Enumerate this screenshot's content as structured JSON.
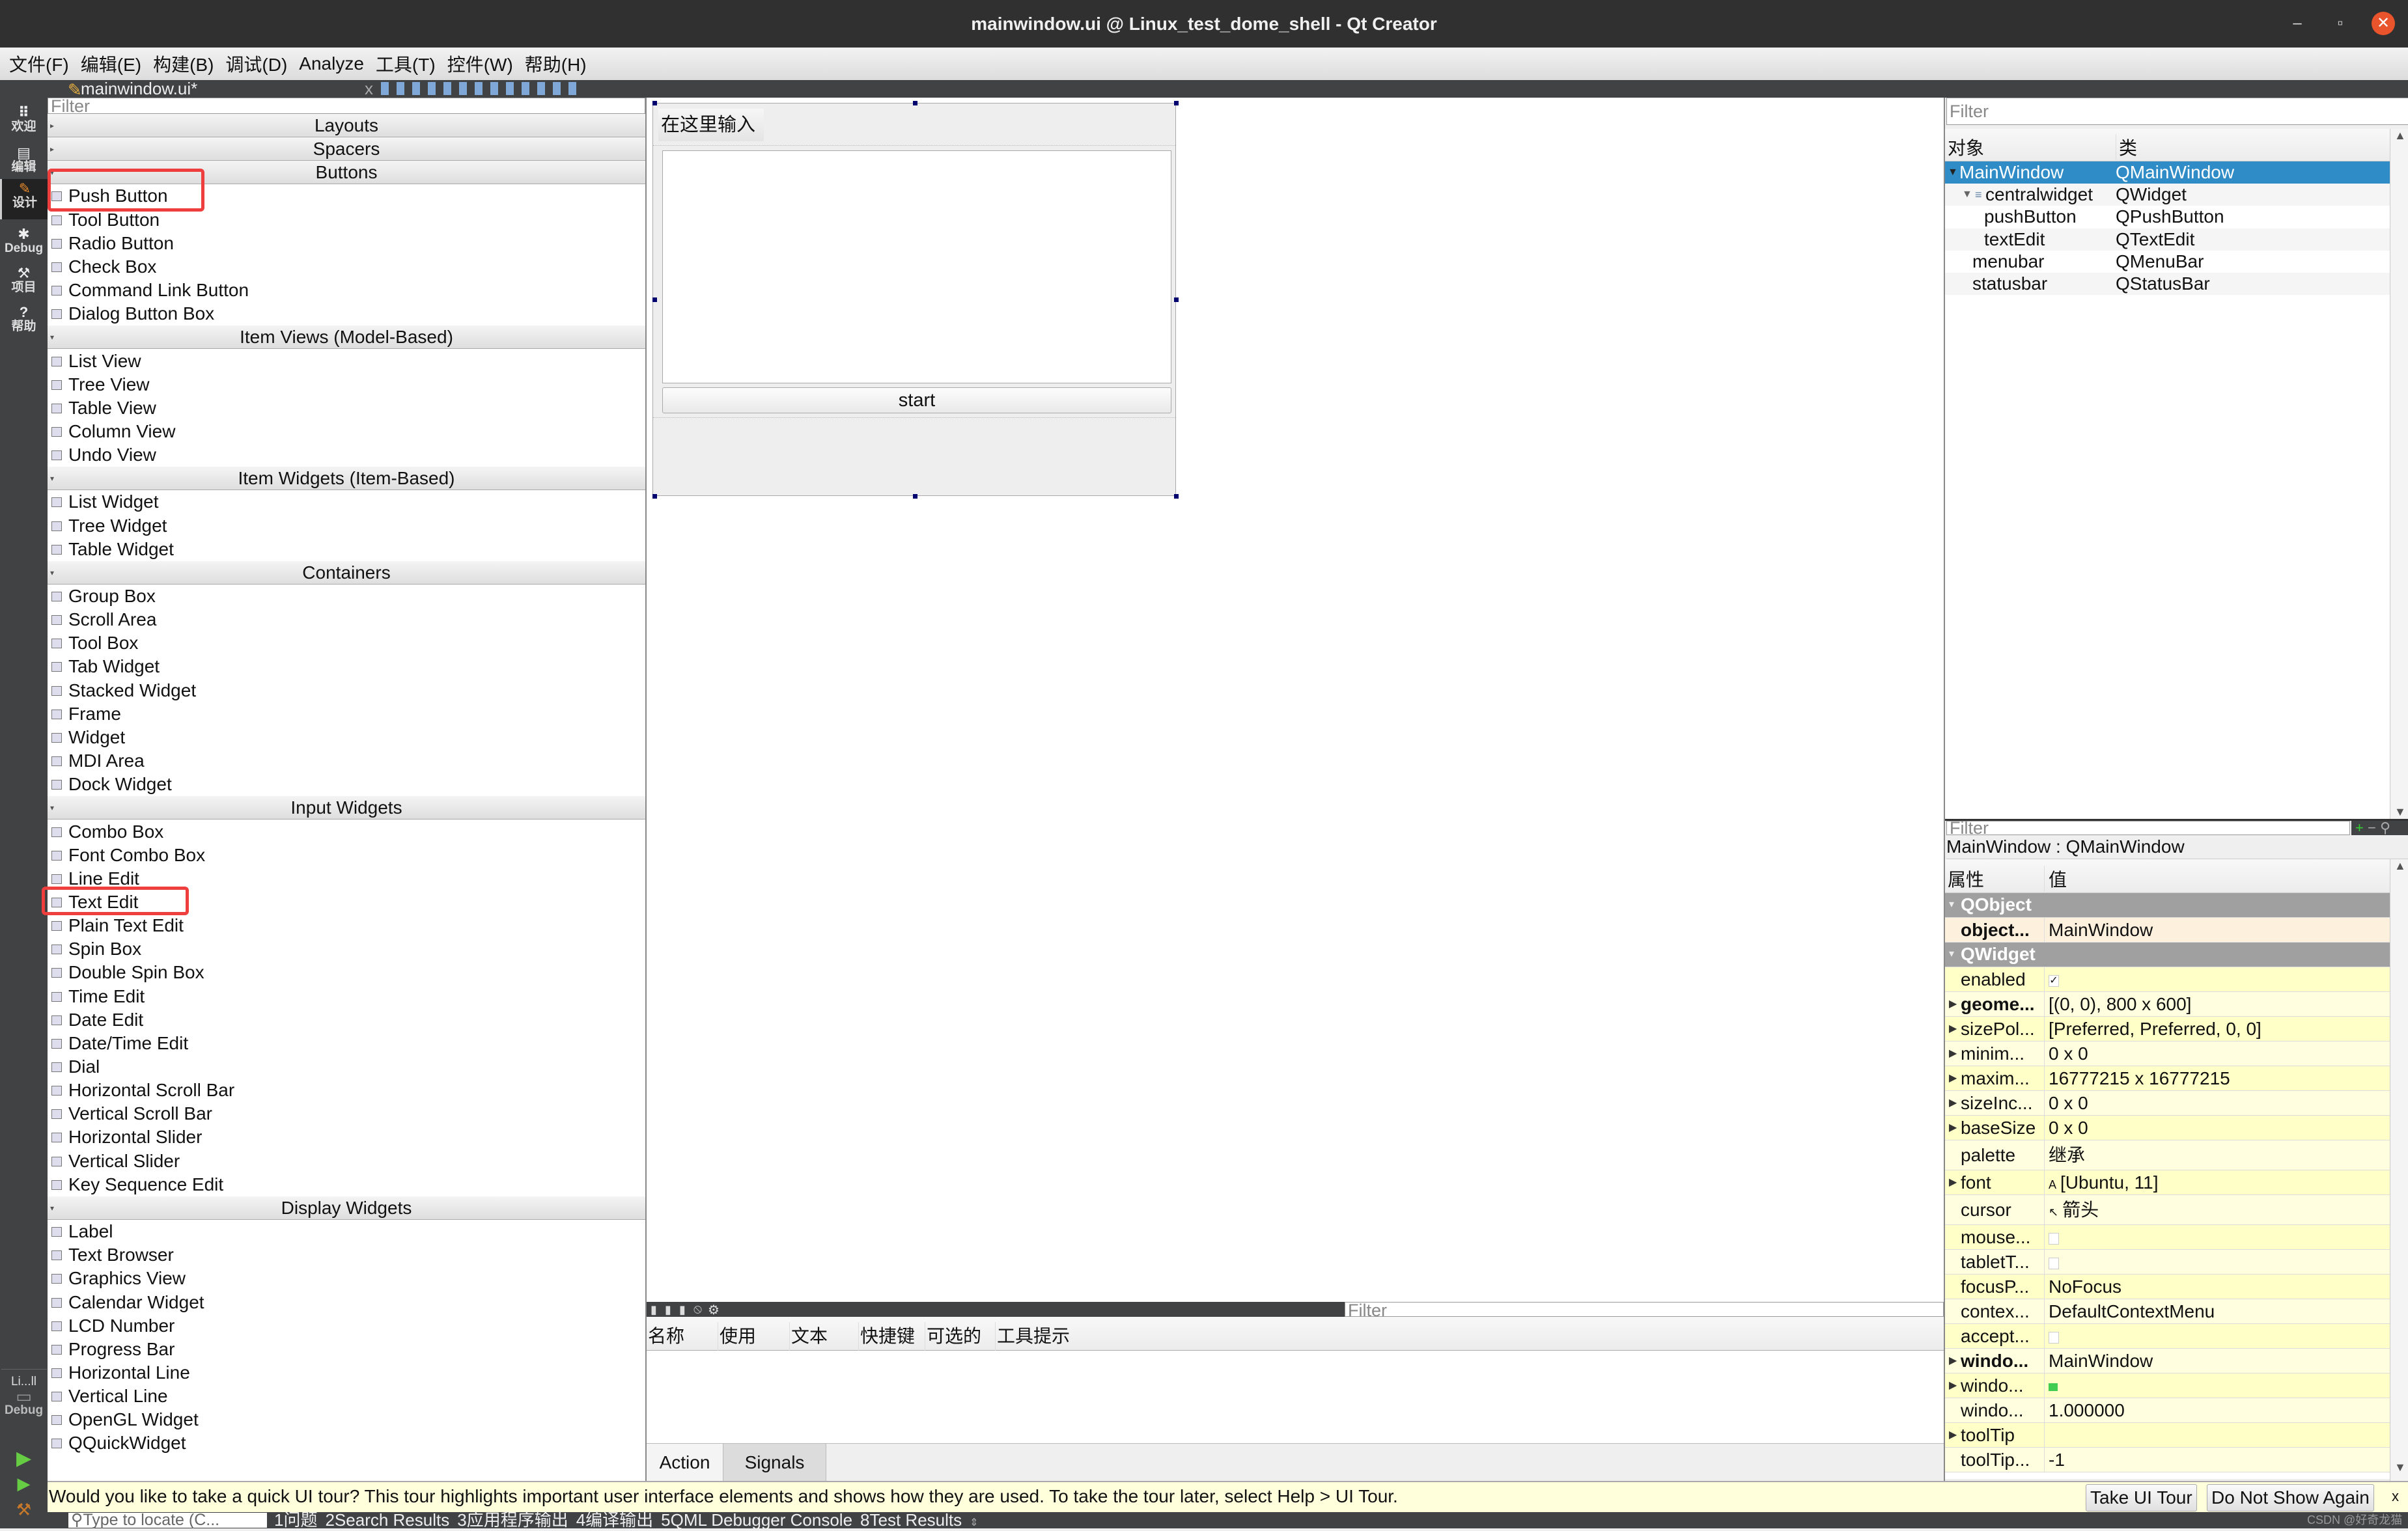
{
  "window": {
    "title": "mainwindow.ui @ Linux_test_dome_shell - Qt Creator",
    "minimize": "–",
    "restore": "▫",
    "close": "✕"
  },
  "menu": [
    "文件(F)",
    "编辑(E)",
    "构建(B)",
    "调试(D)",
    "Analyze",
    "工具(T)",
    "控件(W)",
    "帮助(H)"
  ],
  "editor_tab": {
    "label": "mainwindow.ui*",
    "close": "x"
  },
  "modes": [
    {
      "label": "欢迎",
      "icon": "grid-icon",
      "glyph": "⠿"
    },
    {
      "label": "编辑",
      "icon": "document-icon",
      "glyph": "▤"
    },
    {
      "label": "设计",
      "icon": "pencil-icon",
      "glyph": "✎",
      "active": true
    },
    {
      "label": "Debug",
      "icon": "bug-icon",
      "glyph": "✱"
    },
    {
      "label": "项目",
      "icon": "wrench-icon",
      "glyph": "⚒"
    },
    {
      "label": "帮助",
      "icon": "help-icon",
      "glyph": "?"
    }
  ],
  "kit": {
    "name": "Li...ll",
    "mode": "Debug"
  },
  "widget_box": {
    "filter_placeholder": "Filter",
    "sections": [
      {
        "header": "Layouts",
        "items": []
      },
      {
        "header": "Spacers",
        "items": []
      },
      {
        "header": "Buttons",
        "items": [
          "Push Button",
          "Tool Button",
          "Radio Button",
          "Check Box",
          "Command Link Button",
          "Dialog Button Box"
        ]
      },
      {
        "header": "Item Views (Model-Based)",
        "items": [
          "List View",
          "Tree View",
          "Table View",
          "Column View",
          "Undo View"
        ]
      },
      {
        "header": "Item Widgets (Item-Based)",
        "items": [
          "List Widget",
          "Tree Widget",
          "Table Widget"
        ]
      },
      {
        "header": "Containers",
        "items": [
          "Group Box",
          "Scroll Area",
          "Tool Box",
          "Tab Widget",
          "Stacked Widget",
          "Frame",
          "Widget",
          "MDI Area",
          "Dock Widget"
        ]
      },
      {
        "header": "Input Widgets",
        "items": [
          "Combo Box",
          "Font Combo Box",
          "Line Edit",
          "Text Edit",
          "Plain Text Edit",
          "Spin Box",
          "Double Spin Box",
          "Time Edit",
          "Date Edit",
          "Date/Time Edit",
          "Dial",
          "Horizontal Scroll Bar",
          "Vertical Scroll Bar",
          "Horizontal Slider",
          "Vertical Slider",
          "Key Sequence Edit"
        ]
      },
      {
        "header": "Display Widgets",
        "items": [
          "Label",
          "Text Browser",
          "Graphics View",
          "Calendar Widget",
          "LCD Number",
          "Progress Bar",
          "Horizontal Line",
          "Vertical Line",
          "OpenGL Widget",
          "QQuickWidget"
        ]
      }
    ]
  },
  "form": {
    "label": "在这里输入",
    "text_edit": "",
    "button": "start"
  },
  "action_editor": {
    "filter_placeholder": "Filter",
    "columns": [
      "名称",
      "使用",
      "文本",
      "快捷键",
      "可选的",
      "工具提示"
    ],
    "tabs": [
      "Action Editor",
      "Signals _Slots E..."
    ]
  },
  "object_inspector": {
    "filter_placeholder": "Filter",
    "columns": [
      "对象",
      "类"
    ],
    "rows": [
      {
        "object": "MainWindow",
        "class": "QMainWindow",
        "level": 0,
        "selected": true,
        "expanded": true
      },
      {
        "object": "centralwidget",
        "class": "QWidget",
        "level": 1,
        "expanded": true
      },
      {
        "object": "pushButton",
        "class": "QPushButton",
        "level": 2
      },
      {
        "object": "textEdit",
        "class": "QTextEdit",
        "level": 2
      },
      {
        "object": "menubar",
        "class": "QMenuBar",
        "level": 1
      },
      {
        "object": "statusbar",
        "class": "QStatusBar",
        "level": 1
      }
    ]
  },
  "property_editor": {
    "filter_placeholder": "Filter",
    "object_label": "MainWindow : QMainWindow",
    "columns": [
      "属性",
      "值"
    ],
    "rows": [
      {
        "group": "QObject"
      },
      {
        "name": "object...",
        "value": "MainWindow",
        "bold": true,
        "obj": true
      },
      {
        "group": "QWidget"
      },
      {
        "name": "enabled",
        "check": true
      },
      {
        "name": "geome...",
        "value": "[(0, 0), 800 x 600]",
        "bold": true,
        "expand": true
      },
      {
        "name": "sizePol...",
        "value": "[Preferred, Preferred, 0, 0]",
        "expand": true
      },
      {
        "name": "minim...",
        "value": "0 x 0",
        "expand": true
      },
      {
        "name": "maxim...",
        "value": "16777215 x 16777215",
        "expand": true
      },
      {
        "name": "sizeInc...",
        "value": "0 x 0",
        "expand": true
      },
      {
        "name": "baseSize",
        "value": "0 x 0",
        "expand": true
      },
      {
        "name": "palette",
        "value": "继承",
        "tall": true
      },
      {
        "name": "font",
        "value": "[Ubuntu, 11]",
        "prefix": "A",
        "expand": true
      },
      {
        "name": "cursor",
        "value": "箭头",
        "prefix": "↖",
        "tall": true
      },
      {
        "name": "mouse...",
        "check": false
      },
      {
        "name": "tabletT...",
        "check": false
      },
      {
        "name": "focusP...",
        "value": "NoFocus"
      },
      {
        "name": "contex...",
        "value": "DefaultContextMenu"
      },
      {
        "name": "accept...",
        "check": false
      },
      {
        "name": "windo...",
        "value": "MainWindow",
        "bold": true,
        "expand": true
      },
      {
        "name": "windo...",
        "value": "",
        "qtIcon": true,
        "expand": true
      },
      {
        "name": "windo...",
        "value": "1.000000"
      },
      {
        "name": "toolTip",
        "value": "",
        "expand": true
      },
      {
        "name": "toolTip...",
        "value": "-1"
      }
    ]
  },
  "tour": {
    "message": "Would you like to take a quick UI tour? This tour highlights important user interface elements and shows how they are used. To take the tour later, select Help > UI Tour.",
    "take": "Take UI Tour",
    "dismiss": "Do Not Show Again",
    "close": "x"
  },
  "statusbar": {
    "locate_placeholder": "Type to locate (C...",
    "panes": [
      "1问题",
      "2Search Results",
      "3应用程序输出",
      "4编译输出",
      "5QML Debugger Console",
      "8Test Results"
    ],
    "watermark": "CSDN @好奇龙猫"
  },
  "colors": {
    "selection": "#308cc6",
    "group_header": "#a0a0a0",
    "property_yellow": "#ffffc8",
    "object_row": "#fdf0dc",
    "highlight_box": "#ef3e3e",
    "dark_chrome": "#404244"
  }
}
